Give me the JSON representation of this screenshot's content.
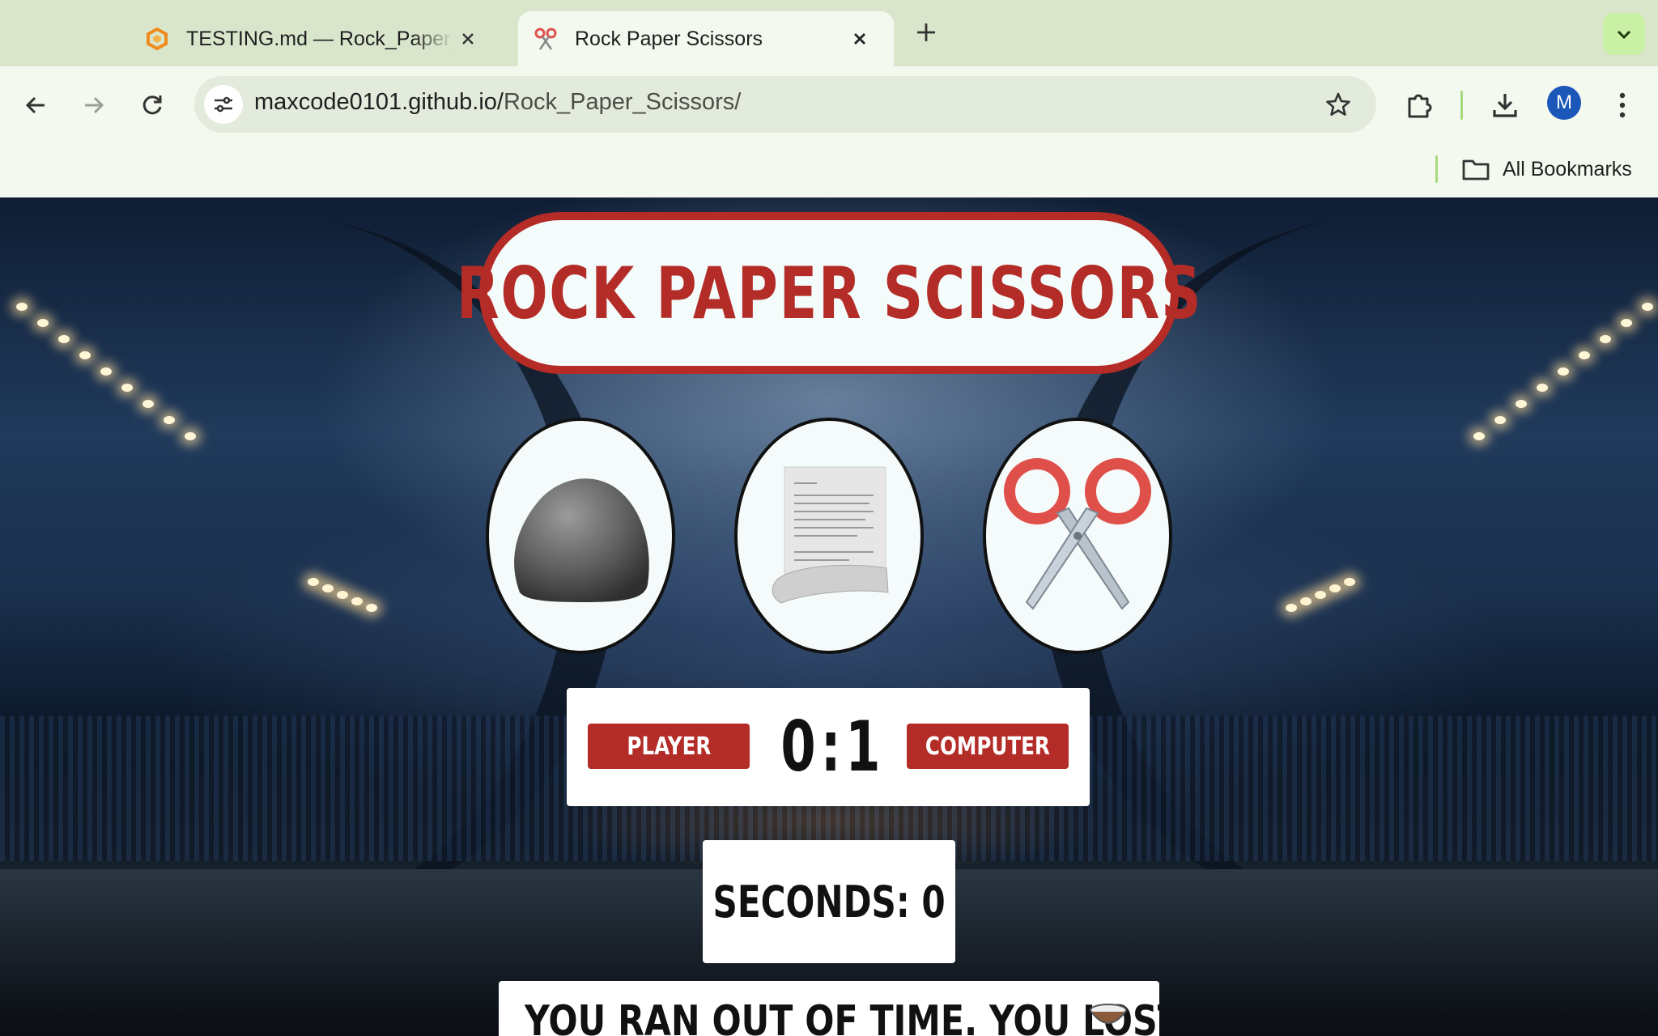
{
  "browser": {
    "tabs": [
      {
        "title": "TESTING.md — Rock_Paper_Scissors",
        "favicon": "orange-g-icon",
        "active": false
      },
      {
        "title": "Rock Paper Scissors",
        "favicon": "scissors-icon",
        "active": true
      }
    ],
    "address": {
      "host": "maxcode0101.github.io/",
      "path": "Rock_Paper_Scissors/"
    },
    "profile_initial": "M",
    "bookmarks_label": "All Bookmarks",
    "accent": "#a7d97d"
  },
  "game": {
    "title": "ROCK PAPER SCISSORS",
    "choices": [
      {
        "name": "rock",
        "icon": "rock-icon"
      },
      {
        "name": "paper",
        "icon": "paper-icon"
      },
      {
        "name": "scissors",
        "icon": "scissors-icon"
      }
    ],
    "player_label": "PLAYER",
    "computer_label": "COMPUTER",
    "player_score": "0",
    "separator": ":",
    "computer_score": "1",
    "seconds_label": "SECONDS:",
    "seconds_value": "0",
    "result_message": "YOU RAN OUT OF TIME. YOU LOST",
    "colors": {
      "primary": "#b42c27",
      "panel": "#ffffff"
    }
  }
}
